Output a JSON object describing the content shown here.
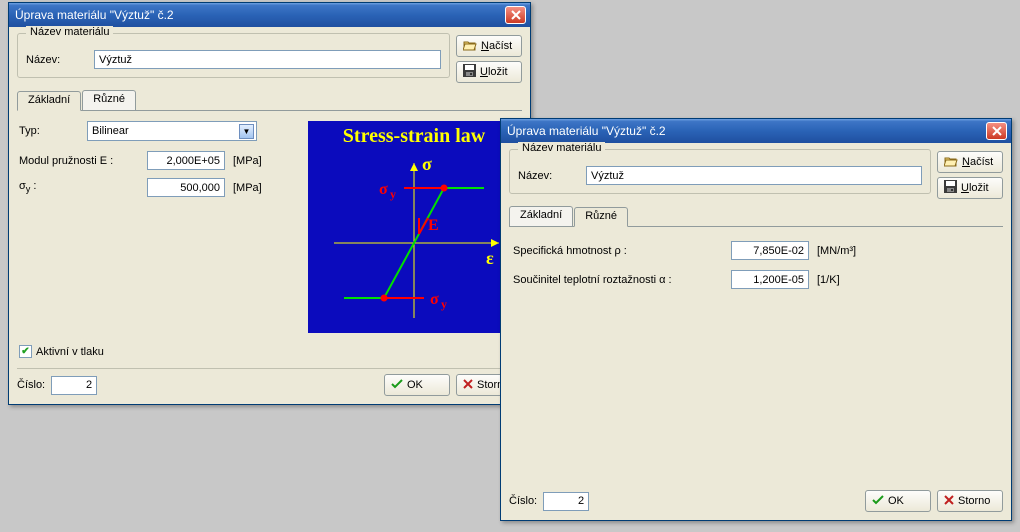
{
  "dlg1": {
    "title": "Úprava materiálu \"Výztuž\" č.2",
    "group_name": "Název materiálu",
    "name_label": "Název:",
    "name_value": "Výztuž",
    "btn_load": "Načíst",
    "btn_save": "Uložit",
    "tab_basic": "Základní",
    "tab_misc": "Různé",
    "type_label": "Typ:",
    "type_value": "Bilinear",
    "modE_label": "Modul pružnosti E :",
    "modE_value": "2,000E+05",
    "modE_unit": "[MPa]",
    "sigy_label": "σy :",
    "sigy_value": "500,000",
    "sigy_unit": "[MPa]",
    "chart_title": "Stress-strain law",
    "sigma": "σ",
    "eps": "ε",
    "E": "E",
    "sig_y": "σy",
    "active_label": "Aktivní v tlaku",
    "cislo_label": "Číslo:",
    "cislo_value": "2",
    "ok": "OK",
    "storno": "Storno"
  },
  "dlg2": {
    "title": "Úprava materiálu \"Výztuž\" č.2",
    "group_name": "Název materiálu",
    "name_label": "Název:",
    "name_value": "Výztuž",
    "btn_load": "Načíst",
    "btn_save": "Uložit",
    "tab_basic": "Základní",
    "tab_misc": "Různé",
    "rho_label": "Specifická hmotnost ρ :",
    "rho_value": "7,850E-02",
    "rho_unit": "[MN/m³]",
    "alpha_label": "Součinitel teplotní roztažnosti α :",
    "alpha_value": "1,200E-05",
    "alpha_unit": "[1/K]",
    "cislo_label": "Číslo:",
    "cislo_value": "2",
    "ok": "OK",
    "storno": "Storno"
  }
}
